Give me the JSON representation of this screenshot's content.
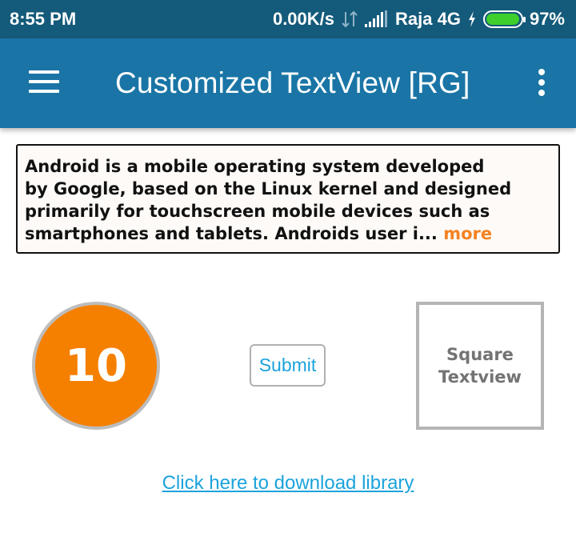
{
  "status_bar": {
    "time": "8:55 PM",
    "network_speed": "0.00K/s",
    "carrier": "Raja 4G",
    "battery_percent": "97%",
    "battery_level": 0.97,
    "background": "#145a7a"
  },
  "app_bar": {
    "title": "Customized TextView [RG]",
    "menu_icon": "hamburger-menu-icon",
    "overflow_icon": "more-vertical-icon",
    "background": "#1a75a6"
  },
  "text_box": {
    "lines": [
      "Android is a mobile operating system developed",
      "by Google, based on the Linux kernel and designed",
      "primarily for touchscreen mobile devices such as"
    ],
    "last_line": "smartphones and tablets. Androids user i...",
    "more_label": "more",
    "more_color": "#f58220"
  },
  "circle": {
    "value": "10",
    "color": "#f58000"
  },
  "submit_button": {
    "label": "Submit"
  },
  "square": {
    "line1": "Square",
    "line2": "Textview"
  },
  "download_link": {
    "label": "Click here to download library",
    "color": "#1ca3dc"
  }
}
